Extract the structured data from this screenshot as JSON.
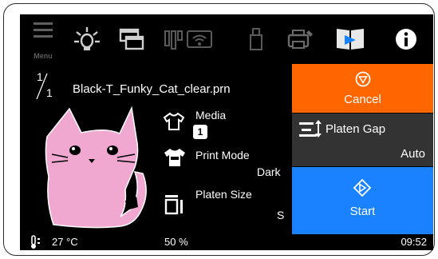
{
  "topbar": {
    "menu_label": "Menu"
  },
  "job": {
    "counter_current": "1",
    "counter_total": "1",
    "file_name": "Black-T_Funky_Cat_clear.prn"
  },
  "settings": {
    "media_label": "Media",
    "media_value": "1",
    "print_mode_label": "Print Mode",
    "print_mode_value": "Dark",
    "platen_size_label": "Platen Size",
    "platen_size_value": "S"
  },
  "actions": {
    "cancel_label": "Cancel",
    "platen_gap_label": "Platen Gap",
    "platen_gap_value": "Auto",
    "start_label": "Start"
  },
  "status": {
    "temperature": "27 °C",
    "percent": "50 %",
    "time": "09:52"
  },
  "colors": {
    "cancel": "#ff6600",
    "platen_gap": "#333333",
    "start": "#1a82ff",
    "preview_cat": "#f0a8d0"
  }
}
